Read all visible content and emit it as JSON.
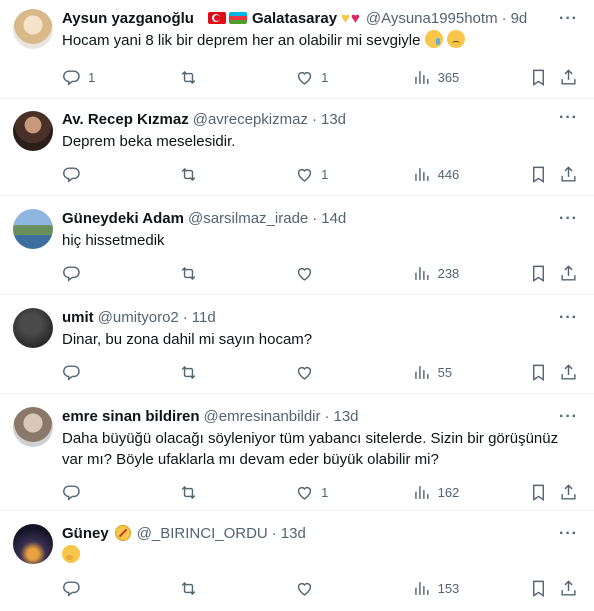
{
  "tweets": [
    {
      "name": "Aysun yazganoğlu",
      "name_suffix": "Galatasaray",
      "handle": "@Aysuna1995hotm",
      "time": "9d",
      "text": "Hocam yani 8 lik bir deprem her an olabilir mi sevgiyle",
      "replies": "1",
      "retweets": "",
      "likes": "1",
      "views": "365"
    },
    {
      "name": "Av. Recep Kızmaz",
      "handle": "@avrecepkizmaz",
      "time": "13d",
      "text": "Deprem beka meselesidir.",
      "replies": "",
      "retweets": "",
      "likes": "1",
      "views": "446"
    },
    {
      "name": "Güneydeki Adam",
      "handle": "@sarsilmaz_irade",
      "time": "14d",
      "text": "hiç hissetmedik",
      "replies": "",
      "retweets": "",
      "likes": "",
      "views": "238"
    },
    {
      "name": "umit",
      "handle": "@umityoro2",
      "time": "11d",
      "text": "Dinar, bu zona dahil mi sayın hocam?",
      "replies": "",
      "retweets": "",
      "likes": "",
      "views": "55"
    },
    {
      "name": "emre sinan bildiren",
      "handle": "@emresinanbildir",
      "time": "13d",
      "text": "Daha büyüğü olacağı söyleniyor tüm yabancı sitelerde. Sizin bir görüşünüz var mı? Böyle ufaklarla mı devam eder büyük olabilir mi?",
      "replies": "",
      "retweets": "",
      "likes": "1",
      "views": "162"
    },
    {
      "name": "Güney",
      "handle": "@_BIRINCI_ORDU",
      "time": "13d",
      "text": "",
      "replies": "",
      "retweets": "",
      "likes": "",
      "views": "153"
    }
  ],
  "colors": {
    "text_primary": "#0f1419",
    "text_secondary": "#536471",
    "divider": "#eff3f4"
  },
  "icons": [
    "reply-icon",
    "retweet-icon",
    "like-icon",
    "views-icon",
    "bookmark-icon",
    "share-icon",
    "more-icon"
  ]
}
